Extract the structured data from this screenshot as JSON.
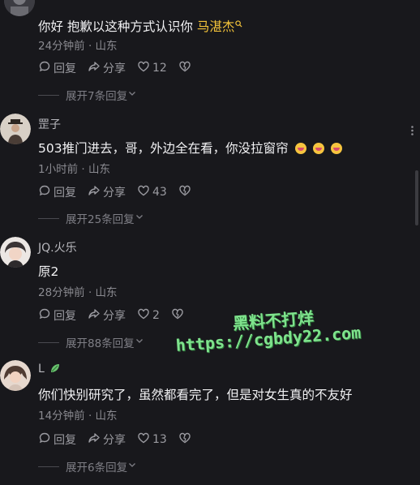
{
  "comments": [
    {
      "username": "",
      "text": "你好 抱歉以这种方式认识你 ",
      "mention": "马湛杰",
      "meta": "24分钟前 · 山东",
      "reply": "回复",
      "share": "分享",
      "likes": "12",
      "expand": "展开7条回复"
    },
    {
      "username": "罡子",
      "text": "503推门进去，哥，外边全在看，你没拉窗帘",
      "meta": "1小时前 · 山东",
      "reply": "回复",
      "share": "分享",
      "likes": "43",
      "expand": "展开25条回复"
    },
    {
      "username": "JQ.火乐",
      "text": "原2",
      "meta": "28分钟前 · 山东",
      "reply": "回复",
      "share": "分享",
      "likes": "2",
      "expand": "展开88条回复"
    },
    {
      "username": "L",
      "text": "你们快别研究了，虽然都看完了，但是对女生真的不友好",
      "meta": "14分钟前 · 山东",
      "reply": "回复",
      "share": "分享",
      "likes": "13",
      "expand": "展开6条回复"
    }
  ],
  "watermark": {
    "line1": "黑料不打烊",
    "line2": "https://cgbdy22.com"
  },
  "colors": {
    "background": "#18181c",
    "mention": "#f3c33a",
    "watermark": "#7fe38d"
  },
  "icons": [
    "reply-icon",
    "share-icon",
    "heart-icon",
    "dislike-heart-icon",
    "chevron-down-icon",
    "more-icon",
    "search-icon",
    "leaf-icon"
  ]
}
